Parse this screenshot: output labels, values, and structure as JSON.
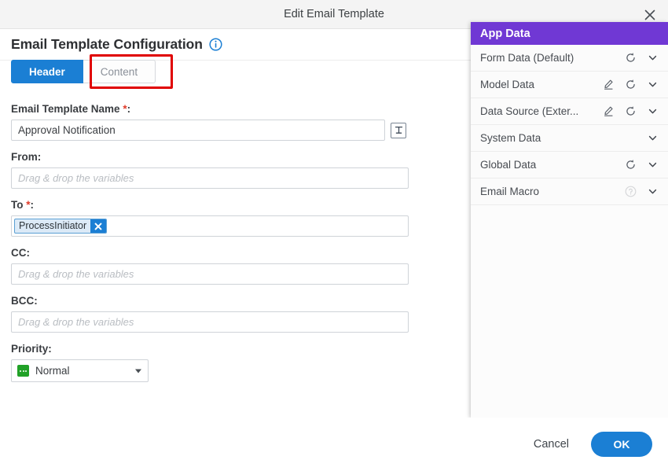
{
  "window": {
    "title": "Edit Email Template",
    "close_icon": "close-icon"
  },
  "page": {
    "heading": "Email Template Configuration",
    "info_icon": "info-icon"
  },
  "tabs": [
    {
      "label": "Header",
      "active": true
    },
    {
      "label": "Content",
      "active": false,
      "highlighted": true
    }
  ],
  "form": {
    "template_name": {
      "label": "Email Template Name",
      "required": true,
      "value": "Approval Notification",
      "action_icon": "text-insert-icon"
    },
    "from": {
      "label": "From",
      "required": false,
      "value": "",
      "placeholder": "Drag & drop the variables"
    },
    "to": {
      "label": "To",
      "required": true,
      "chips": [
        {
          "label": "ProcessInitiator",
          "remove_icon": "close-icon"
        }
      ]
    },
    "cc": {
      "label": "CC",
      "required": false,
      "value": "",
      "placeholder": "Drag & drop the variables"
    },
    "bcc": {
      "label": "BCC",
      "required": false,
      "value": "",
      "placeholder": "Drag & drop the variables"
    },
    "priority": {
      "label": "Priority",
      "value": "Normal",
      "icon": "priority-normal-icon"
    }
  },
  "app_data": {
    "title": "App Data",
    "header_color": "#7038d4",
    "rows": [
      {
        "label": "Form Data (Default)",
        "edit": false,
        "refresh": true,
        "help": false,
        "expand": true
      },
      {
        "label": "Model Data",
        "edit": true,
        "refresh": true,
        "help": false,
        "expand": true
      },
      {
        "label": "Data Source (Exter...",
        "edit": true,
        "refresh": true,
        "help": false,
        "expand": true
      },
      {
        "label": "System Data",
        "edit": false,
        "refresh": false,
        "help": false,
        "expand": true
      },
      {
        "label": "Global Data",
        "edit": false,
        "refresh": true,
        "help": false,
        "expand": true
      },
      {
        "label": "Email Macro",
        "edit": false,
        "refresh": false,
        "help": true,
        "expand": true
      }
    ]
  },
  "footer": {
    "cancel_label": "Cancel",
    "ok_label": "OK",
    "ok_color": "#1b7fd4"
  }
}
